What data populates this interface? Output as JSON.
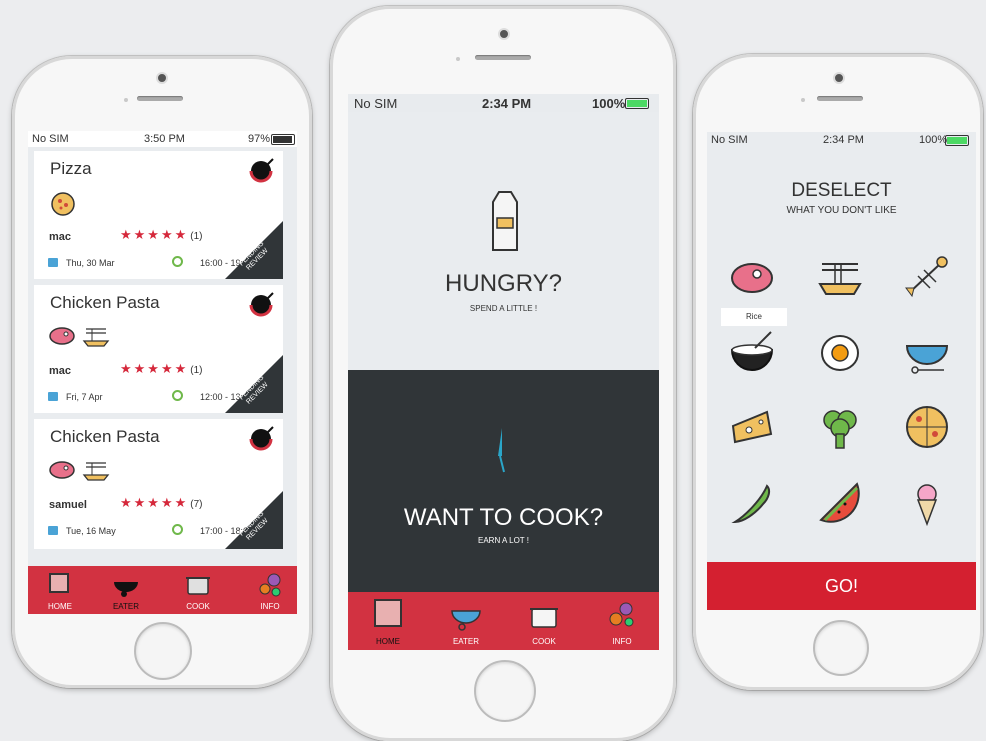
{
  "left_phone": {
    "status": {
      "carrier": "No SIM",
      "time": "3:50 PM",
      "battery": "97%"
    },
    "cards": [
      {
        "title": "Pizza",
        "user": "mac",
        "rating_count": "(1)",
        "date": "Thu, 30 Mar",
        "time": "16:00 - 19:00",
        "ribbon": "PENDING REVIEW"
      },
      {
        "title": "Chicken Pasta",
        "user": "mac",
        "rating_count": "(1)",
        "date": "Fri, 7 Apr",
        "time": "12:00 - 13:00",
        "ribbon": "PENDING REVIEW"
      },
      {
        "title": "Chicken Pasta",
        "user": "samuel",
        "rating_count": "(7)",
        "date": "Tue, 16 May",
        "time": "17:00 - 18:00",
        "ribbon": "PENDING REVIEW"
      }
    ],
    "stars": "★★★★★",
    "tabs": [
      "HOME",
      "EATER",
      "COOK",
      "INFO"
    ]
  },
  "middle_phone": {
    "status": {
      "carrier": "No SIM",
      "time": "2:34 PM",
      "battery": "100%"
    },
    "hungry_title": "HUNGRY?",
    "hungry_sub": "SPEND A LITTLE !",
    "cook_title": "WANT TO COOK?",
    "cook_sub": "EARN A LOT !",
    "tabs": [
      "HOME",
      "EATER",
      "COOK",
      "INFO"
    ]
  },
  "right_phone": {
    "status": {
      "carrier": "No SIM",
      "time": "2:34 PM",
      "battery": "100%"
    },
    "title": "DESELECT",
    "subtitle": "WHAT YOU DON'T LIKE",
    "tooltip": "Rice",
    "go_label": "GO!"
  },
  "colors": {
    "accent": "#d23241",
    "dark": "#303538",
    "battery_green": "#4cd964"
  }
}
